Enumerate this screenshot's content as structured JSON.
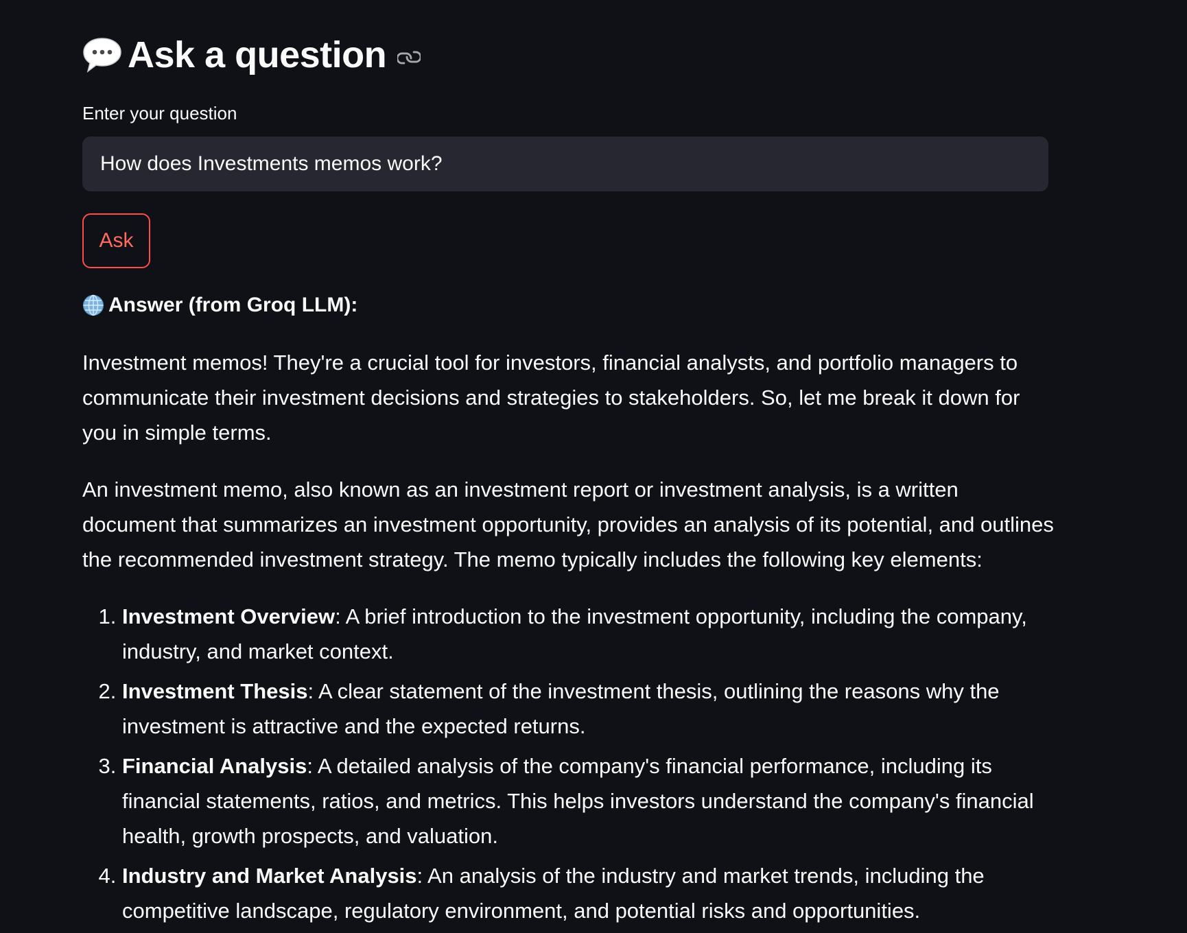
{
  "header": {
    "title": "Ask a question",
    "title_icon": "speech-balloon-icon",
    "anchor_icon": "link-icon"
  },
  "form": {
    "label": "Enter your question",
    "input_value": "How does Investments memos work?",
    "button_label": "Ask"
  },
  "answer": {
    "heading": "Answer (from Groq LLM):",
    "heading_icon": "globe-icon",
    "paragraphs": [
      "Investment memos! They're a crucial tool for investors, financial analysts, and portfolio managers to communicate their investment decisions and strategies to stakeholders. So, let me break it down for you in simple terms.",
      "An investment memo, also known as an investment report or investment analysis, is a written document that summarizes an investment opportunity, provides an analysis of its potential, and outlines the recommended investment strategy. The memo typically includes the following key elements:"
    ],
    "items": [
      {
        "term": "Investment Overview",
        "text": ": A brief introduction to the investment opportunity, including the company, industry, and market context."
      },
      {
        "term": "Investment Thesis",
        "text": ": A clear statement of the investment thesis, outlining the reasons why the investment is attractive and the expected returns."
      },
      {
        "term": "Financial Analysis",
        "text": ": A detailed analysis of the company's financial performance, including its financial statements, ratios, and metrics. This helps investors understand the company's financial health, growth prospects, and valuation."
      },
      {
        "term": "Industry and Market Analysis",
        "text": ": An analysis of the industry and market trends, including the competitive landscape, regulatory environment, and potential risks and opportunities."
      }
    ]
  },
  "colors": {
    "background": "#0f1117",
    "input_background": "#262730",
    "accent": "#ff4b4b",
    "text": "#fafafa"
  }
}
